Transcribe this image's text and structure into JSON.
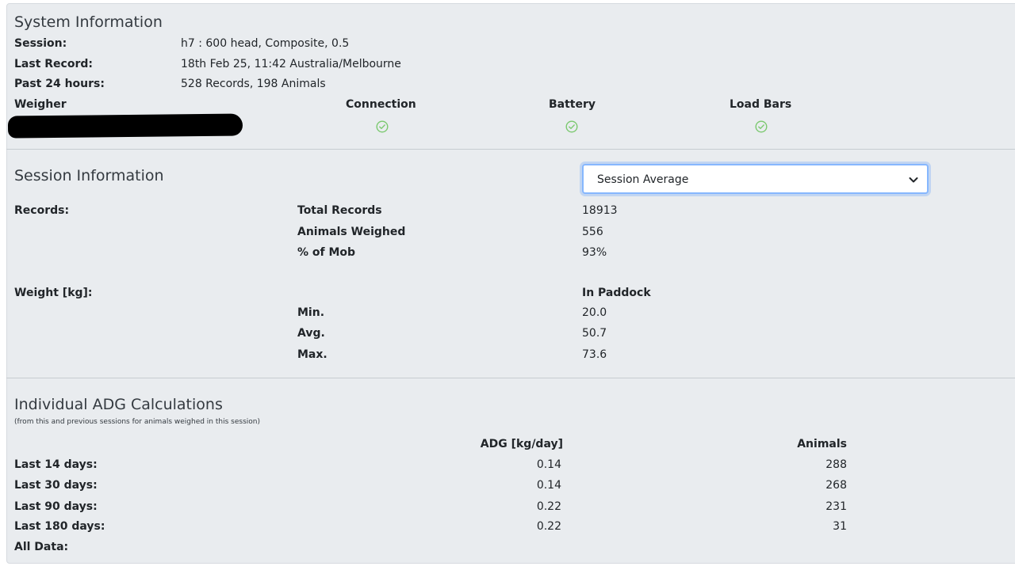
{
  "system": {
    "title": "System Information",
    "session_label": "Session:",
    "session_value": "h7 : 600 head, Composite, 0.5",
    "last_record_label": "Last Record:",
    "last_record_value": "18th Feb 25, 11:42 Australia/Melbourne",
    "past24_label": "Past 24 hours:",
    "past24_value": "528 Records, 198 Animals",
    "weigher_label": "Weigher",
    "connection_label": "Connection",
    "battery_label": "Battery",
    "loadbars_label": "Load Bars",
    "status_color": "#7bc96f"
  },
  "session": {
    "title": "Session Information",
    "select_value": "Session Average",
    "records_label": "Records:",
    "total_records_label": "Total Records",
    "total_records_value": "18913",
    "animals_weighed_label": "Animals Weighed",
    "animals_weighed_value": "556",
    "pct_mob_label": "% of Mob",
    "pct_mob_value": "93%",
    "weight_label": "Weight [kg]:",
    "in_paddock_label": "In Paddock",
    "min_label": "Min.",
    "min_value": "20.0",
    "avg_label": "Avg.",
    "avg_value": "50.7",
    "max_label": "Max.",
    "max_value": "73.6"
  },
  "adg": {
    "title": "Individual ADG Calculations",
    "note": "(from this and previous sessions for animals weighed in this session)",
    "col_adg": "ADG [kg/day]",
    "col_animals": "Animals",
    "rows": [
      {
        "label": "Last 14 days:",
        "adg": "0.14",
        "animals": "288"
      },
      {
        "label": "Last 30 days:",
        "adg": "0.14",
        "animals": "268"
      },
      {
        "label": "Last 90 days:",
        "adg": "0.22",
        "animals": "231"
      },
      {
        "label": "Last 180 days:",
        "adg": "0.22",
        "animals": "31"
      },
      {
        "label": "All Data:",
        "adg": "",
        "animals": ""
      }
    ]
  }
}
